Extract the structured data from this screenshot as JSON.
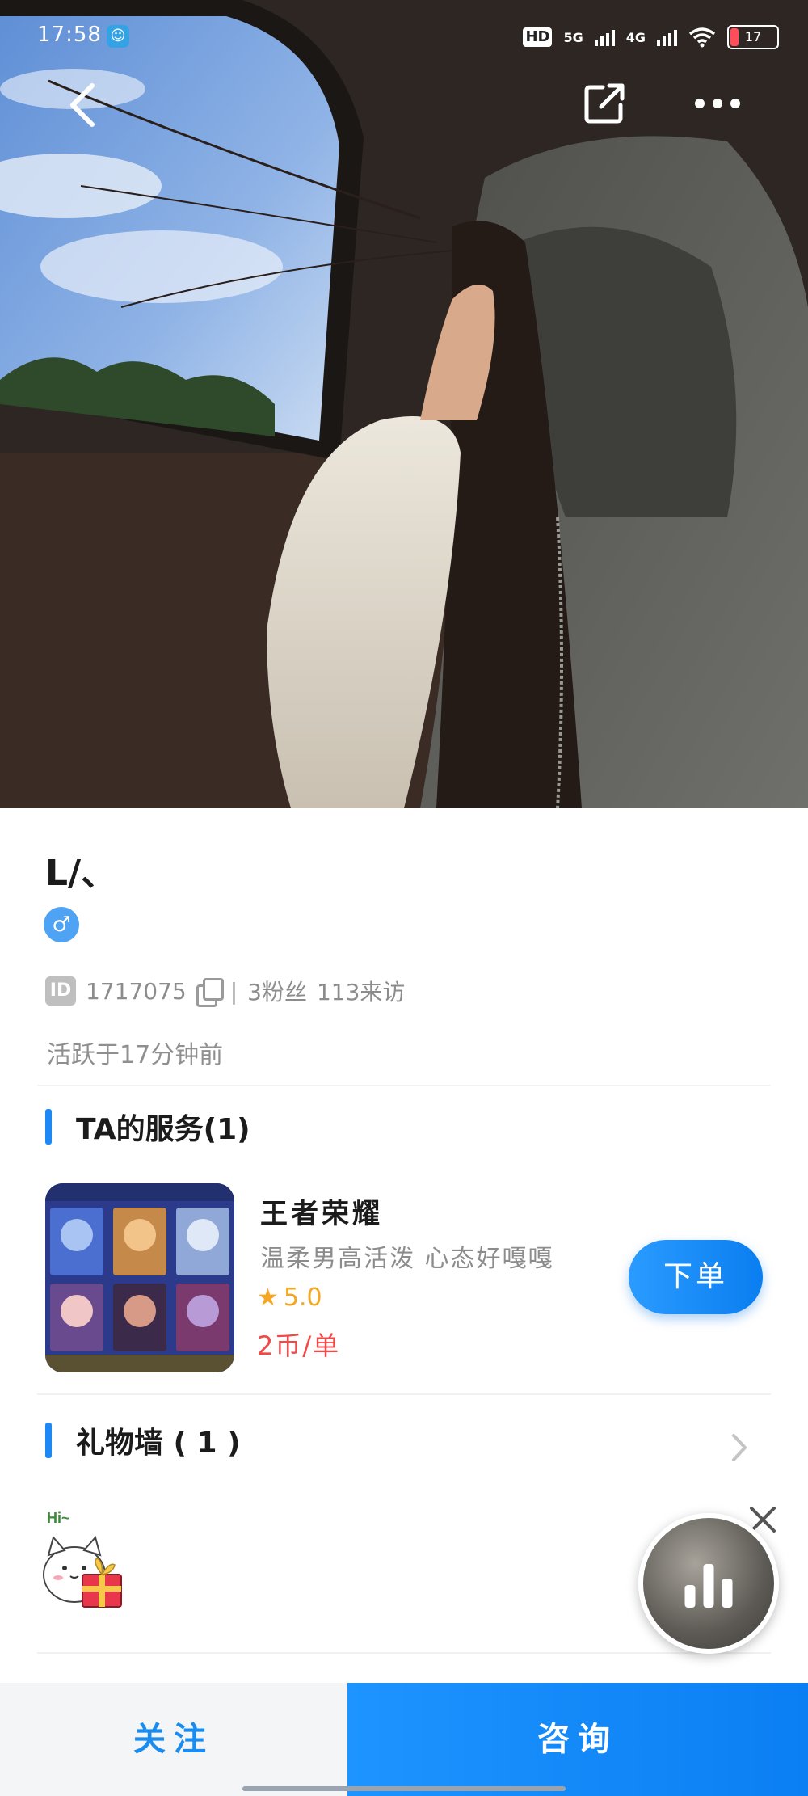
{
  "status_bar": {
    "time": "17:58",
    "hd_label": "HD",
    "network_1": "5G",
    "network_2": "4G",
    "battery": "17"
  },
  "profile": {
    "nickname": "L/、",
    "gender_symbol": "♂",
    "id_tag": "ID",
    "id_value": "1717075",
    "separator": "|",
    "fans": "3粉丝",
    "visits": "113来访",
    "active_time": "活跃于17分钟前"
  },
  "services": {
    "title": "TA的服务(1)",
    "items": [
      {
        "name": "王者荣耀",
        "description": "温柔男高活泼 心态好嘎嘎",
        "rating": "5.0",
        "price": "2币/单",
        "order_label": "下单"
      }
    ]
  },
  "gift_wall": {
    "title": "礼物墙 ( 1 )",
    "gift_hi_text": "Hi~"
  },
  "bottom_bar": {
    "follow_label": "关注",
    "consult_label": "咨询"
  },
  "colors": {
    "accent": "#1e88f5",
    "price": "#f24848",
    "rating": "#f5a623"
  }
}
